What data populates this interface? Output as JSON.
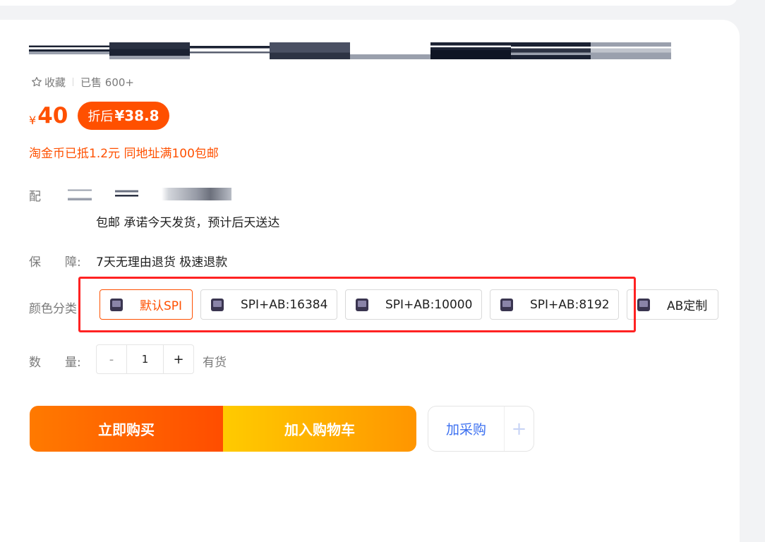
{
  "favorite": {
    "label": "收藏",
    "icon": "star-icon"
  },
  "sales": "已售 600+",
  "price": {
    "currency": "¥",
    "value": "40"
  },
  "discount": {
    "label": "折后",
    "value": "¥38.8"
  },
  "promo": "淘金币已抵1.2元 同地址满100包邮",
  "shipping": {
    "label": "配",
    "text": "包邮  承诺今天发货，预计后天送达"
  },
  "guarantee": {
    "label": "保　　障:",
    "text": "7天无理由退货 极速退款"
  },
  "color": {
    "label": "颜色分类:",
    "options": [
      {
        "label": "默认SPI",
        "selected": true
      },
      {
        "label": "SPI+AB:16384",
        "selected": false
      },
      {
        "label": "SPI+AB:10000",
        "selected": false
      },
      {
        "label": "SPI+AB:8192",
        "selected": false
      },
      {
        "label": "AB定制",
        "selected": false
      }
    ]
  },
  "quantity": {
    "label": "数　　量:",
    "minus": "-",
    "value": "1",
    "plus": "+",
    "stock": "有货"
  },
  "actions": {
    "buy_now": "立即购买",
    "add_cart": "加入购物车",
    "procure": "加采购",
    "procure_plus": "+"
  },
  "colors": {
    "accent": "#ff5000",
    "link": "#3b6ff0",
    "highlight": "#ff2222"
  }
}
